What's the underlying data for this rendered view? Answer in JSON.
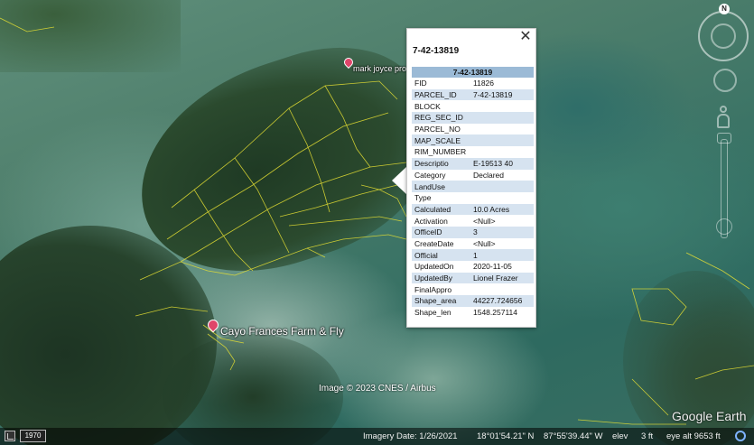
{
  "map": {
    "placemarks": [
      {
        "label": "mark joyce pro"
      },
      {
        "label": "Cayo Frances Farm & Fly"
      }
    ],
    "imagery_credit": "Image © 2023 CNES / Airbus",
    "logo": "Google Earth",
    "colors": {
      "parcel_line": "#e6e033",
      "pin": "#e0456a"
    }
  },
  "navigation": {
    "north_label": "N",
    "icons": [
      "compass-ring",
      "look-joystick",
      "street-view-pegman",
      "zoom-slider"
    ]
  },
  "popup": {
    "title": "7-42-13819",
    "close_icon": "✕",
    "table_header": "7-42-13819",
    "rows": [
      {
        "key": "FID",
        "value": "11826"
      },
      {
        "key": "PARCEL_ID",
        "value": "7-42-13819"
      },
      {
        "key": "BLOCK",
        "value": ""
      },
      {
        "key": "REG_SEC_ID",
        "value": ""
      },
      {
        "key": "PARCEL_NO",
        "value": ""
      },
      {
        "key": "MAP_SCALE",
        "value": ""
      },
      {
        "key": "RIM_NUMBER",
        "value": ""
      },
      {
        "key": "Descriptio",
        "value": "E-19513 40"
      },
      {
        "key": "Category",
        "value": "Declared"
      },
      {
        "key": "LandUse",
        "value": ""
      },
      {
        "key": "Type",
        "value": ""
      },
      {
        "key": "Calculated",
        "value": "10.0 Acres"
      },
      {
        "key": "Activation",
        "value": "<Null>"
      },
      {
        "key": "OfficeID",
        "value": "3"
      },
      {
        "key": "CreateDate",
        "value": "<Null>"
      },
      {
        "key": "Official",
        "value": "1"
      },
      {
        "key": "UpdatedOn",
        "value": "2020-11-05"
      },
      {
        "key": "UpdatedBy",
        "value": "Lionel Frazer"
      },
      {
        "key": "FinalAppro",
        "value": ""
      },
      {
        "key": "Shape_area",
        "value": "44227.724656"
      },
      {
        "key": "Shape_len",
        "value": "1548.257114"
      }
    ],
    "colors": {
      "header": "#9bbad6",
      "alt_row": "#d6e3f0"
    }
  },
  "statusbar": {
    "year": "1970",
    "imagery_date": "Imagery Date: 1/26/2021",
    "lat": "18°01'54.21\" N",
    "lon": "87°55'39.44\" W",
    "elev_label": "elev",
    "elev_value": "3 ft",
    "eye_alt": "eye alt   9653 ft"
  }
}
